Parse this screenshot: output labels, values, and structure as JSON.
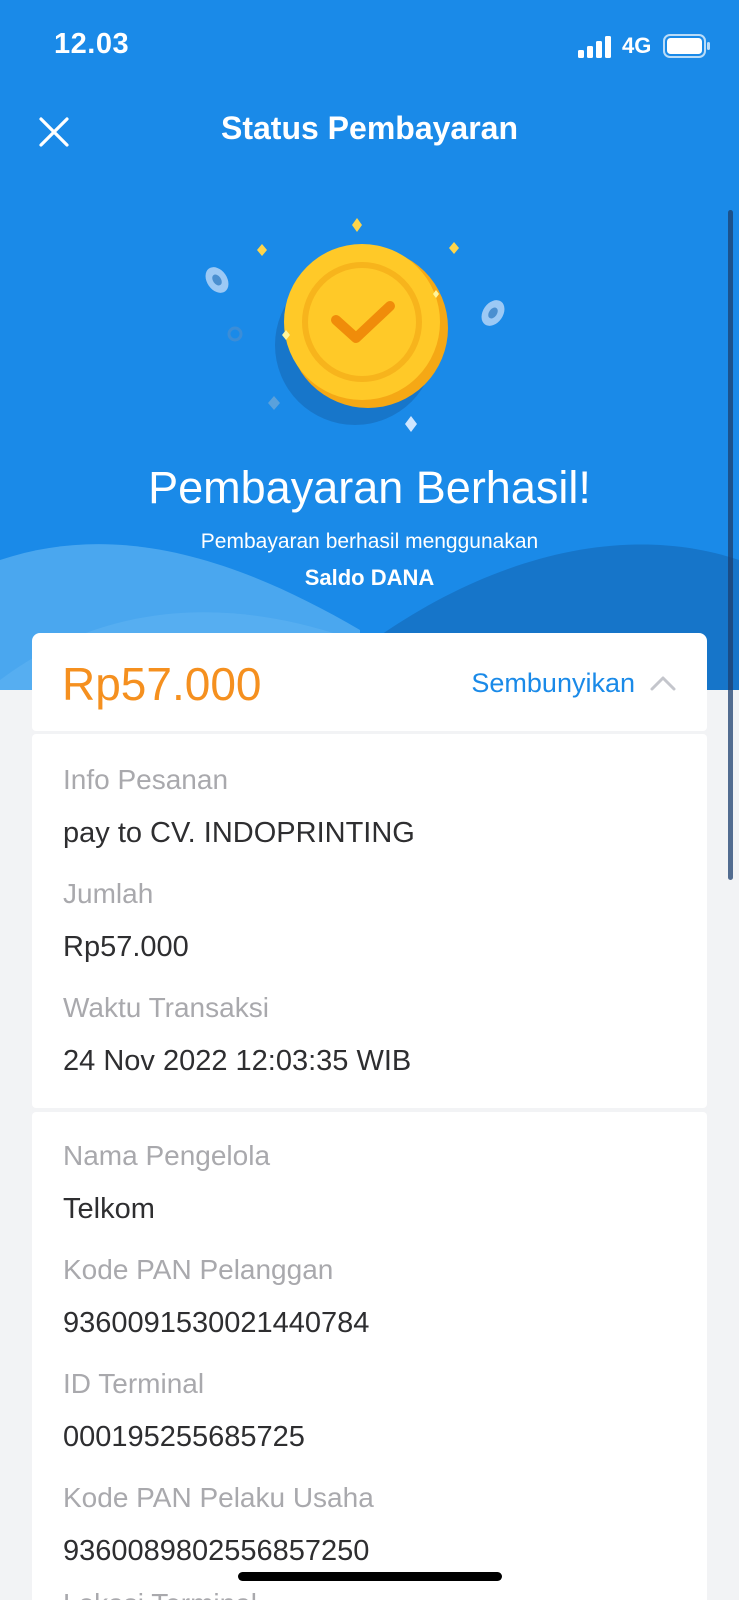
{
  "status_bar": {
    "time": "12.03",
    "network": "4G"
  },
  "header": {
    "title": "Status Pembayaran"
  },
  "success": {
    "title": "Pembayaran Berhasil!",
    "subtitle": "Pembayaran berhasil menggunakan",
    "method": "Saldo DANA"
  },
  "amount": {
    "value": "Rp57.000",
    "toggle_label": "Sembunyikan"
  },
  "order_info": [
    {
      "label": "Info Pesanan",
      "value": "pay to CV. INDOPRINTING"
    },
    {
      "label": "Jumlah",
      "value": "Rp57.000"
    },
    {
      "label": "Waktu Transaksi",
      "value": "24 Nov 2022 12:03:35 WIB"
    }
  ],
  "details": [
    {
      "label": "Nama Pengelola",
      "value": "Telkom"
    },
    {
      "label": "Kode PAN Pelanggan",
      "value": "9360091530021440784"
    },
    {
      "label": "ID Terminal",
      "value": "000195255685725"
    },
    {
      "label": "Kode PAN Pelaku Usaha",
      "value": "9360089802556857250"
    },
    {
      "label": "Lokasi Terminal",
      "value": ""
    }
  ],
  "colors": {
    "primary_blue": "#1a8ae8",
    "amount_orange": "#f5901f",
    "label_gray": "#a9a9ad",
    "background": "#f2f3f5"
  },
  "icons": [
    "close-icon",
    "signal-icon",
    "battery-icon",
    "chevron-up-icon",
    "coin-check-icon"
  ]
}
